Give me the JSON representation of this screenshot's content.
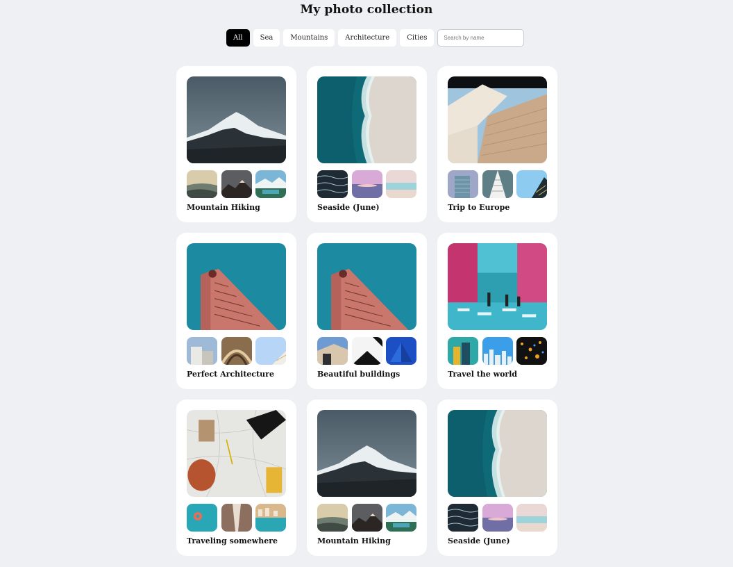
{
  "page": {
    "title": "My photo collection"
  },
  "filters": {
    "chips": [
      "All",
      "Sea",
      "Mountains",
      "Architecture",
      "Cities"
    ],
    "active": "All",
    "search_placeholder": "Search by name"
  },
  "cards": [
    {
      "title": "Mountain Hiking",
      "hero": "mountain-photo",
      "thumbs": [
        "misty-hills-photo",
        "dusk-peaks-photo",
        "alpine-lake-photo"
      ]
    },
    {
      "title": "Seaside (June)",
      "hero": "aerial-beach-photo",
      "thumbs": [
        "dark-waves-photo",
        "pink-sunset-sea-photo",
        "pastel-shore-photo"
      ]
    },
    {
      "title": "Trip to Europe",
      "hero": "modern-facade-photo",
      "thumbs": [
        "glass-tower-photo",
        "white-balconies-photo",
        "blue-sky-building-photo"
      ]
    },
    {
      "title": "Perfect Architecture",
      "hero": "red-tower-photo",
      "thumbs": [
        "white-blocks-photo",
        "arched-ceiling-photo",
        "balcony-corner-photo"
      ]
    },
    {
      "title": "Beautiful buildings",
      "hero": "red-tower-photo",
      "thumbs": [
        "house-angle-photo",
        "black-white-roof-photo",
        "blue-pyramid-photo"
      ]
    },
    {
      "title": "Travel the world",
      "hero": "neon-street-photo",
      "thumbs": [
        "teal-towers-photo",
        "skyline-photo",
        "night-lights-photo"
      ]
    },
    {
      "title": "Traveling somewhere",
      "hero": "travel-map-photo",
      "thumbs": [
        "beach-float-photo",
        "narrow-alley-photo",
        "coastal-town-photo"
      ]
    },
    {
      "title": "Mountain Hiking",
      "hero": "mountain-photo",
      "thumbs": [
        "misty-hills-photo",
        "dusk-peaks-photo",
        "alpine-lake-photo"
      ]
    },
    {
      "title": "Seaside (June)",
      "hero": "aerial-beach-photo",
      "thumbs": [
        "dark-waves-photo",
        "pink-sunset-sea-photo",
        "pastel-shore-photo"
      ]
    }
  ]
}
